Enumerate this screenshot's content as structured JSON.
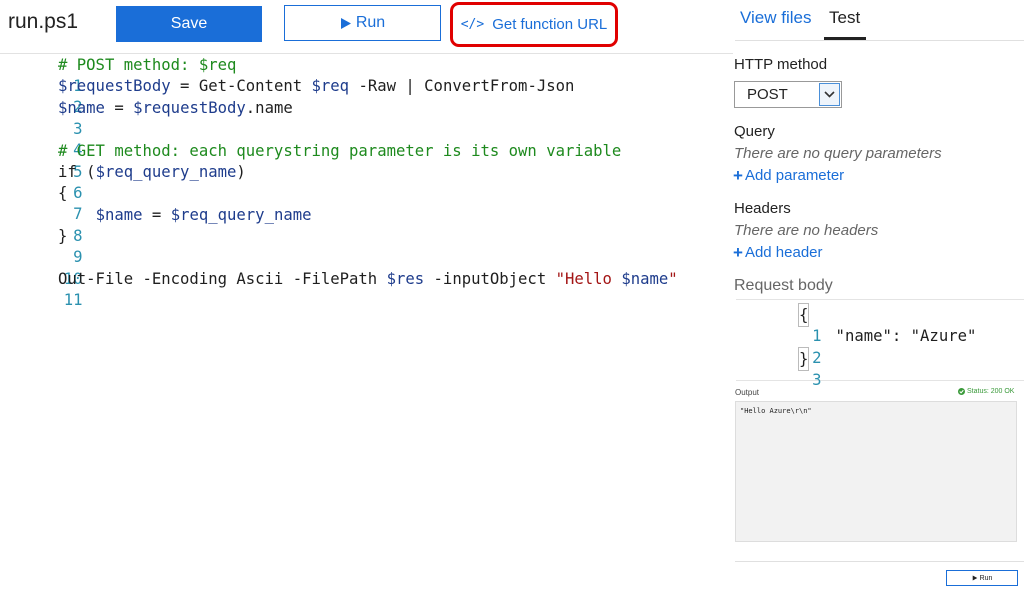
{
  "header": {
    "file_title": "run.ps1",
    "save_label": "Save",
    "run_label": "Run",
    "get_url_label": "Get function URL"
  },
  "editor": {
    "lines": [
      {
        "n": "1",
        "text": "# POST method: $req"
      },
      {
        "n": "2",
        "a": "$requestBody",
        "b": " = Get-Content ",
        "c": "$req",
        "d": " -Raw | ConvertFrom-Json"
      },
      {
        "n": "3",
        "a": "$name",
        "b": " = ",
        "c": "$requestBody",
        "d": ".name"
      },
      {
        "n": "4"
      },
      {
        "n": "5",
        "text": "# GET method: each querystring parameter is its own variable"
      },
      {
        "n": "6",
        "a": "if (",
        "b": "$req_query_name",
        "c": ")"
      },
      {
        "n": "7",
        "text": "{"
      },
      {
        "n": "8",
        "pad": "    ",
        "a": "$name",
        "b": " = ",
        "c": "$req_query_name"
      },
      {
        "n": "9",
        "text": "}"
      },
      {
        "n": "10"
      },
      {
        "n": "11",
        "a": "Out-File -Encoding Ascii -FilePath ",
        "b": "$res",
        "c": " -inputObject ",
        "d": "\"Hello ",
        "e": "$name",
        "f": "\""
      }
    ]
  },
  "panel": {
    "tabs": {
      "view_files": "View files",
      "test": "Test"
    },
    "http_method_label": "HTTP method",
    "http_method_value": "POST",
    "query_label": "Query",
    "query_note": "There are no query parameters",
    "add_parameter": "Add parameter",
    "headers_label": "Headers",
    "headers_note": "There are no headers",
    "add_header": "Add header",
    "request_body_label": "Request body",
    "request_body": [
      {
        "n": "1",
        "text": "{"
      },
      {
        "n": "2",
        "text": "    \"name\": \"Azure\""
      },
      {
        "n": "3",
        "text": "}"
      }
    ],
    "output_label": "Output",
    "status": "Status: 200 OK",
    "output_text": "\"Hello Azure\\r\\n\"",
    "run_label": "Run"
  },
  "colors": {
    "accent": "#1a6ed8",
    "highlight_border": "#e00000",
    "comment": "#1e8a1e",
    "variable": "#1e3c8c",
    "string": "#a31515",
    "line_number": "#2b91af",
    "status_ok": "#3a9a3a"
  }
}
